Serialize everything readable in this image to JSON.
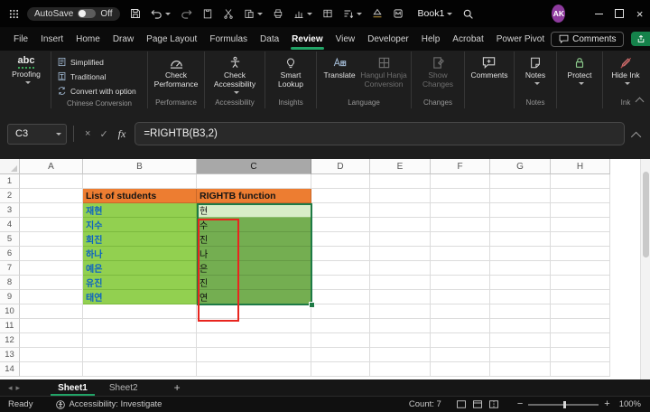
{
  "titlebar": {
    "autosave_label": "AutoSave",
    "autosave_state": "Off",
    "workbook_title": "Book1",
    "avatar_initials": "AK"
  },
  "tabs": {
    "items": [
      "File",
      "Insert",
      "Home",
      "Draw",
      "Page Layout",
      "Formulas",
      "Data",
      "Review",
      "View",
      "Developer",
      "Help",
      "Acrobat",
      "Power Pivot"
    ],
    "active": "Review",
    "comments_label": "Comments"
  },
  "ribbon": {
    "proofing": {
      "button_label": "Proofing"
    },
    "chinese": {
      "simplified": "Simplified",
      "traditional": "Traditional",
      "convert": "Convert with option",
      "group_label": "Chinese Conversion"
    },
    "performance": {
      "button_label": "Check Performance",
      "group_label": "Performance"
    },
    "accessibility": {
      "button_label": "Check Accessibility",
      "group_label": "Accessibility"
    },
    "insights": {
      "button_label": "Smart Lookup",
      "group_label": "Insights"
    },
    "language": {
      "translate_label": "Translate",
      "hangul_label": "Hangul Hanja Conversion",
      "group_label": "Language"
    },
    "changes": {
      "button_label": "Show Changes",
      "group_label": "Changes"
    },
    "comments": {
      "button_label": "Comments"
    },
    "notes": {
      "button_label": "Notes",
      "group_label": "Notes"
    },
    "protect": {
      "button_label": "Protect"
    },
    "ink": {
      "button_label": "Hide Ink",
      "group_label": "Ink"
    }
  },
  "formula_bar": {
    "name_box": "C3",
    "cancel_glyph": "×",
    "enter_glyph": "✓",
    "fx_label": "fx",
    "formula": "=RIGHTB(B3,2)"
  },
  "sheet": {
    "columns": [
      "A",
      "B",
      "C",
      "D",
      "E",
      "F",
      "G",
      "H"
    ],
    "row_numbers": [
      "1",
      "2",
      "3",
      "4",
      "5",
      "6",
      "7",
      "8",
      "9",
      "10",
      "11",
      "12",
      "13",
      "14"
    ],
    "header_b": "List of students",
    "header_c": "RIGHTB function",
    "rows": [
      {
        "name": "재현",
        "result": "현"
      },
      {
        "name": "지수",
        "result": "수"
      },
      {
        "name": "회진",
        "result": "진"
      },
      {
        "name": "하나",
        "result": "나"
      },
      {
        "name": "예은",
        "result": "은"
      },
      {
        "name": "유진",
        "result": "진"
      },
      {
        "name": "태연",
        "result": "연"
      }
    ],
    "selected_cell": "C3"
  },
  "sheet_tabs": {
    "items": [
      "Sheet1",
      "Sheet2"
    ],
    "active": "Sheet1",
    "add_label": "+"
  },
  "status_bar": {
    "ready": "Ready",
    "accessibility": "Accessibility: Investigate",
    "count": "Count: 7",
    "zoom_minus": "−",
    "zoom_plus": "+",
    "zoom": "100%"
  },
  "colors": {
    "accent_green": "#21A366",
    "selection_green": "#1E7A46",
    "header_orange": "#ED7D31",
    "fill_green": "#92D050",
    "name_blue": "#0B62C4",
    "annotation_red": "#E8251F",
    "avatar_purple": "#8E3B9E"
  }
}
